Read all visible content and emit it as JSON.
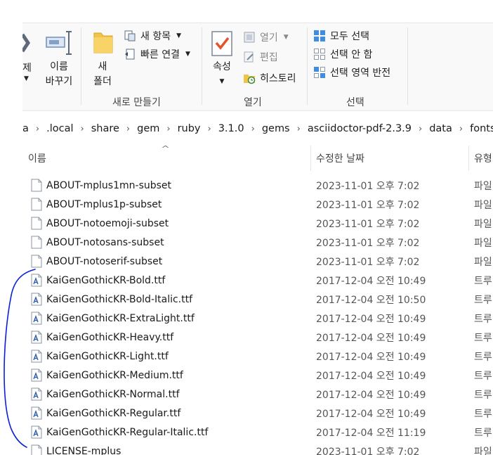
{
  "ribbon": {
    "clipboard": {
      "delete_label": "제",
      "rename_label_line1": "이름",
      "rename_label_line2": "바꾸기"
    },
    "new_group": {
      "new_folder_line1": "새",
      "new_folder_line2": "폴더",
      "new_item_label": "새 항목",
      "easy_access_label": "빠른 연결",
      "group_label": "새로 만들기"
    },
    "open_group": {
      "properties_label": "속성",
      "open_label": "열기",
      "edit_label": "편집",
      "history_label": "히스토리",
      "group_label": "열기"
    },
    "select_group": {
      "select_all_label": "모두 선택",
      "select_none_label": "선택 안 함",
      "invert_selection_label": "선택 영역 반전",
      "group_label": "선택"
    }
  },
  "address_bar": {
    "crumbs": [
      ".local",
      "share",
      "gem",
      "ruby",
      "3.1.0",
      "gems",
      "asciidoctor-pdf-2.3.9",
      "data",
      "fonts"
    ],
    "leading_fragment": "a"
  },
  "file_list": {
    "columns": {
      "name": "이름",
      "date_modified": "수정한 날짜",
      "type": "유형"
    },
    "files": [
      {
        "name": "ABOUT-mplus1mn-subset",
        "date": "2023-11-01 오후 7:02",
        "type": "파일",
        "kind": "generic"
      },
      {
        "name": "ABOUT-mplus1p-subset",
        "date": "2023-11-01 오후 7:02",
        "type": "파일",
        "kind": "generic"
      },
      {
        "name": "ABOUT-notoemoji-subset",
        "date": "2023-11-01 오후 7:02",
        "type": "파일",
        "kind": "generic"
      },
      {
        "name": "ABOUT-notosans-subset",
        "date": "2023-11-01 오후 7:02",
        "type": "파일",
        "kind": "generic"
      },
      {
        "name": "ABOUT-notoserif-subset",
        "date": "2023-11-01 오후 7:02",
        "type": "파일",
        "kind": "generic"
      },
      {
        "name": "KaiGenGothicKR-Bold.ttf",
        "date": "2017-12-04 오전 10:49",
        "type": "트루",
        "kind": "font"
      },
      {
        "name": "KaiGenGothicKR-Bold-Italic.ttf",
        "date": "2017-12-04 오전 10:50",
        "type": "트루",
        "kind": "font"
      },
      {
        "name": "KaiGenGothicKR-ExtraLight.ttf",
        "date": "2017-12-04 오전 10:49",
        "type": "트루",
        "kind": "font"
      },
      {
        "name": "KaiGenGothicKR-Heavy.ttf",
        "date": "2017-12-04 오전 10:49",
        "type": "트루",
        "kind": "font"
      },
      {
        "name": "KaiGenGothicKR-Light.ttf",
        "date": "2017-12-04 오전 10:49",
        "type": "트루",
        "kind": "font"
      },
      {
        "name": "KaiGenGothicKR-Medium.ttf",
        "date": "2017-12-04 오전 10:49",
        "type": "트루",
        "kind": "font"
      },
      {
        "name": "KaiGenGothicKR-Normal.ttf",
        "date": "2017-12-04 오전 10:49",
        "type": "트루",
        "kind": "font"
      },
      {
        "name": "KaiGenGothicKR-Regular.ttf",
        "date": "2017-12-04 오전 10:49",
        "type": "트루",
        "kind": "font"
      },
      {
        "name": "KaiGenGothicKR-Regular-Italic.ttf",
        "date": "2017-12-04 오전 11:19",
        "type": "트루",
        "kind": "font"
      },
      {
        "name": "LICENSE-mplus",
        "date": "2023-11-01 오후 7:02",
        "type": "파일",
        "kind": "generic"
      }
    ]
  },
  "colors": {
    "accent_blue": "#1f6fd1",
    "annotation_ink": "#0a1fd6",
    "folder_yellow": "#f2c349"
  }
}
